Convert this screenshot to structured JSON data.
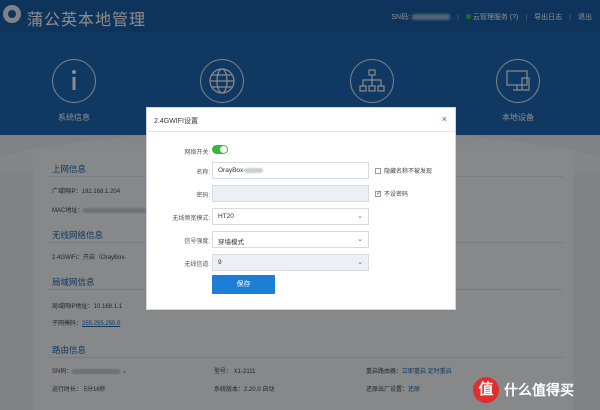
{
  "header": {
    "title": "蒲公英本地管理",
    "sn_label": "SN码:",
    "cloud_label": "云管理服务 (?)",
    "logout": "导出日志",
    "exit": "退出"
  },
  "nav": {
    "items": [
      {
        "label": "系统信息",
        "icon": "info-icon"
      },
      {
        "label": "",
        "icon": "globe-icon"
      },
      {
        "label": "",
        "icon": "network-icon"
      },
      {
        "label": "本地设备",
        "icon": "monitor-icon"
      }
    ]
  },
  "content": {
    "internet_title": "上网信息",
    "wan_ip": "广域网IP：192.168.1.204",
    "mac_label": "MAC地址：",
    "wifi_title": "无线网络信息",
    "wifi_24": "2.4GWiFi：开启（OrayBox-",
    "lan_title": "局域网信息",
    "lan_ip": "局域网IP地址：10.168.1.1",
    "subnet_label": "子网掩码：",
    "subnet_value": "255.255.255.0",
    "router_title": "路由信息",
    "sn_label": "SN码：",
    "model": "型号：  X1-2111",
    "reboot_label": "重启路由器：",
    "reboot_now": "立即重启",
    "reboot_timer": "定时重启",
    "uptime": "运行时长：  5分16秒",
    "firmware": "系统版本：2.20.0  自动",
    "factory_label": "还原出厂设置：",
    "factory_action": "还原"
  },
  "modal": {
    "title": "2.4GWIFI设置",
    "close": "×",
    "switch_label": "网络开关:",
    "switch_on": true,
    "name_label": "名称:",
    "name_value": "OrayBox-",
    "hide_name_label": "隐藏名称不被发现",
    "password_label": "密码:",
    "no_password_label": "不设密码",
    "no_password_checked": true,
    "mode_label": "无线频宽模式:",
    "mode_value": "HT20",
    "signal_label": "信号强度:",
    "signal_value": "穿墙模式",
    "channel_label": "无线信道:",
    "channel_value": "9",
    "save": "保存"
  },
  "watermark": {
    "badge": "值",
    "text": "什么值得买"
  },
  "colors": {
    "brand_blue": "#1d68b4",
    "toggle_green": "#3cb53c",
    "button_blue": "#1d7ed6"
  }
}
